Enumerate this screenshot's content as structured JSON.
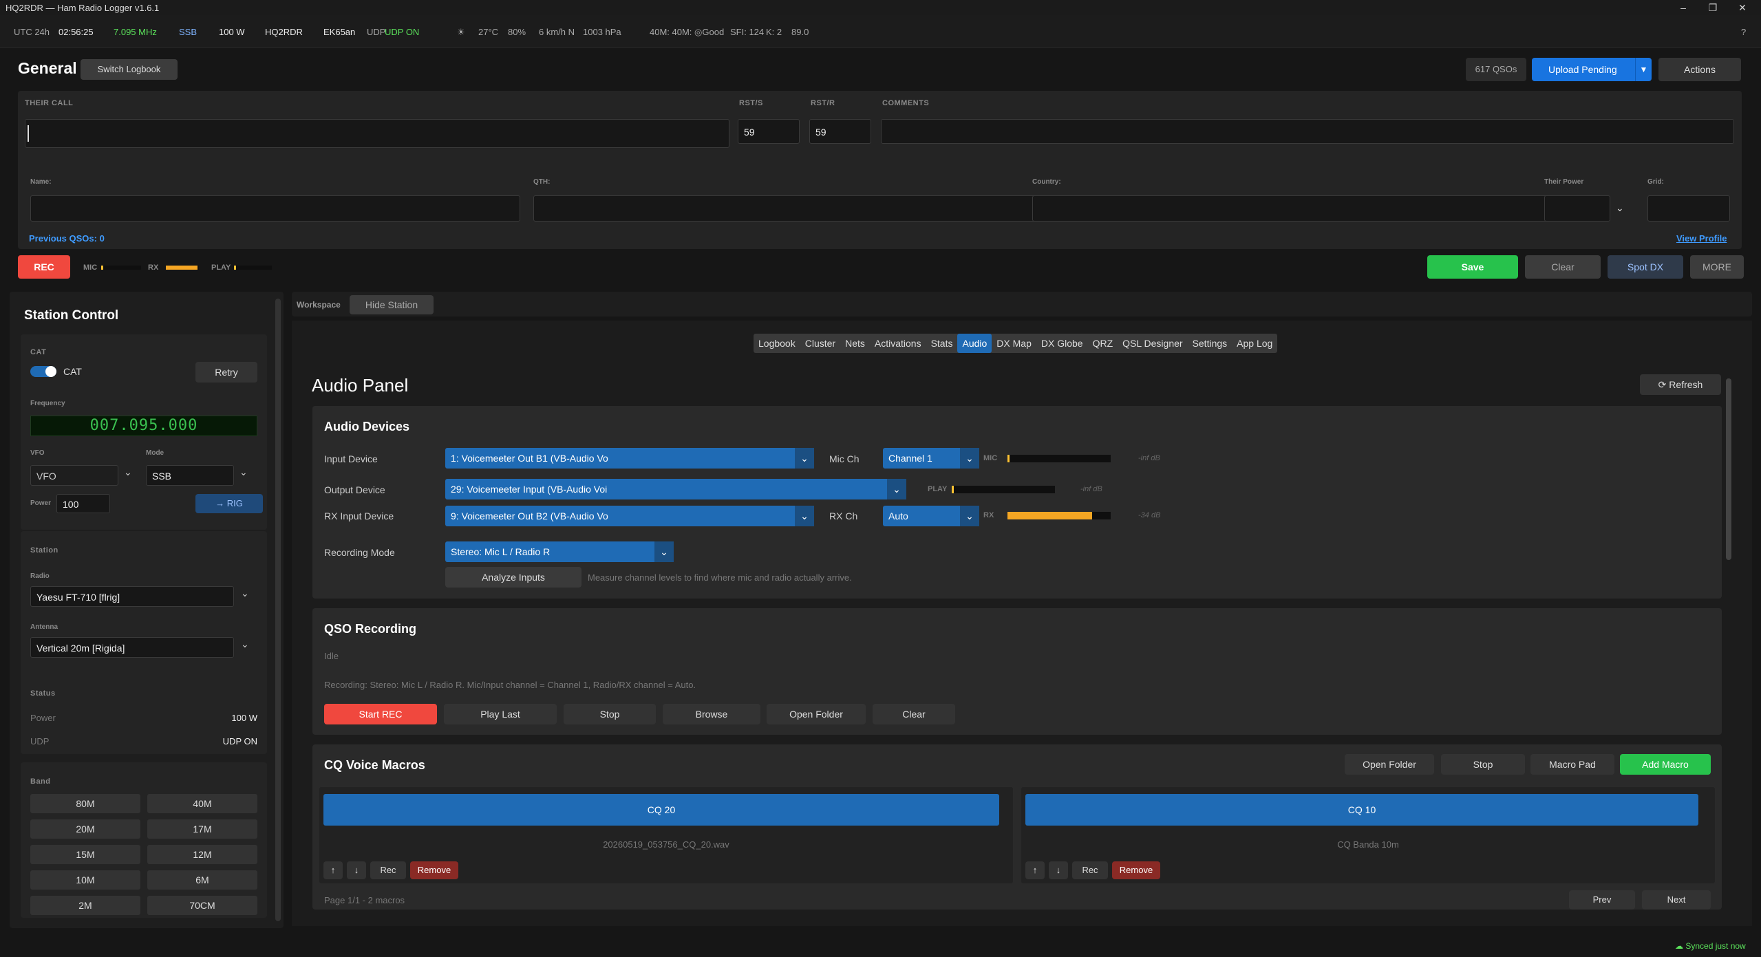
{
  "window": {
    "title": "HQ2RDR — Ham Radio Logger  v1.6.1"
  },
  "status": {
    "utc": "UTC 24h",
    "time": "02:56:25",
    "freq": "7.095 MHz",
    "mode": "SSB",
    "power": "100 W",
    "call": "HQ2RDR",
    "grid": "EK65an",
    "udp_label": "UDP",
    "udp_state": "UDP ON",
    "temp": "27°C",
    "hum": "80%",
    "wind": "6 km/h N",
    "pres": "1003 hPa",
    "bands": "40M: 40M: ◎Good",
    "sfi": "SFI: 124",
    "k": "K: 2",
    "solar": "89.0",
    "help": "?"
  },
  "header": {
    "title": "General",
    "switch": "Switch Logbook",
    "qsos": "617 QSOs",
    "upload": "Upload Pending",
    "actions": "Actions"
  },
  "entry": {
    "their_call": "THEIR CALL",
    "rsts": "RST/S",
    "rstr": "RST/R",
    "comments": "COMMENTS",
    "rsts_val": "59",
    "rstr_val": "59",
    "name": "Name:",
    "qth": "QTH:",
    "country": "Country:",
    "their_power": "Their Power",
    "grid": "Grid:",
    "prev": "Previous QSOs: 0",
    "profile": "View Profile"
  },
  "recbar": {
    "rec": "REC",
    "mic": "MIC",
    "rx": "RX",
    "play": "PLAY",
    "save": "Save",
    "clear": "Clear",
    "spot": "Spot DX",
    "more": "MORE"
  },
  "station_control": {
    "title": "Station Control",
    "cat": "CAT",
    "cat_toggle": "CAT",
    "retry": "Retry",
    "frequency": "Frequency",
    "freq_display": "007.095.000",
    "vfo_label": "VFO",
    "vfo": "VFO",
    "mode_label": "Mode",
    "mode": "SSB",
    "power_label": "Power",
    "power": "100",
    "rig": "→ RIG",
    "station": "Station",
    "radio_label": "Radio",
    "radio": "Yaesu FT-710 [flrig]",
    "antenna_label": "Antenna",
    "antenna": "Vertical 20m [Rigida]",
    "status": "Status",
    "power2": "Power",
    "power2_val": "100 W",
    "udp": "UDP",
    "udp_val": "UDP ON",
    "band": "Band",
    "bands": [
      "80M",
      "40M",
      "20M",
      "17M",
      "15M",
      "12M",
      "10M",
      "6M",
      "2M",
      "70CM"
    ]
  },
  "workspace": {
    "label": "Workspace",
    "hide": "Hide Station",
    "tabs": [
      "Logbook",
      "Cluster",
      "Nets",
      "Activations",
      "Stats",
      "Audio",
      "DX Map",
      "DX Globe",
      "QRZ",
      "QSL Designer",
      "Settings",
      "App Log"
    ]
  },
  "audio": {
    "title": "Audio Panel",
    "refresh": "Refresh",
    "devices": "Audio Devices",
    "input_label": "Input Device",
    "input": "1: Voicemeeter Out B1 (VB-Audio Vo",
    "micch_label": "Mic Ch",
    "micch": "Channel 1",
    "mic": "MIC",
    "mic_db": "-inf dB",
    "output_label": "Output Device",
    "output": "29: Voicemeeter Input (VB-Audio Voi",
    "play": "PLAY",
    "play_db": "-inf dB",
    "rxin_label": "RX Input Device",
    "rxin": "9: Voicemeeter Out B2 (VB-Audio Vo",
    "rxch_label": "RX Ch",
    "rxch": "Auto",
    "rx": "RX",
    "rx_db": "-34 dB",
    "rx_level": 0.82,
    "recmode_label": "Recording Mode",
    "recmode": "Stereo: Mic L / Radio R",
    "analyze": "Analyze Inputs",
    "analyze_hint": "Measure channel levels to find where mic and radio actually arrive."
  },
  "qso_rec": {
    "title": "QSO Recording",
    "state": "Idle",
    "info": "Recording: Stereo: Mic L / Radio R. Mic/Input channel = Channel 1, Radio/RX channel = Auto.",
    "start": "Start REC",
    "play": "Play Last",
    "stop": "Stop",
    "browse": "Browse",
    "open": "Open Folder",
    "clear": "Clear"
  },
  "macros": {
    "title": "CQ Voice Macros",
    "open": "Open Folder",
    "stop": "Stop",
    "pad": "Macro Pad",
    "add": "Add Macro",
    "items": [
      {
        "name": "CQ 20",
        "file": "20260519_053756_CQ_20.wav"
      },
      {
        "name": "CQ 10",
        "file": "CQ Banda 10m"
      }
    ],
    "rec": "Rec",
    "remove": "Remove",
    "page": "Page 1/1 - 2 macros",
    "prev": "Prev",
    "next": "Next"
  },
  "footer": {
    "synced": "Synced just now"
  }
}
